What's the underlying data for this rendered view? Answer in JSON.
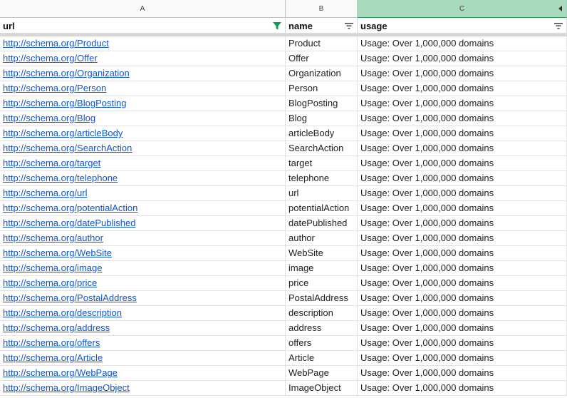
{
  "column_letters": [
    "A",
    "B",
    "C"
  ],
  "headers": {
    "url": "url",
    "name": "name",
    "usage": "usage"
  },
  "rows": [
    {
      "url": "http://schema.org/Product",
      "name": "Product",
      "usage": "Usage: Over 1,000,000 domains"
    },
    {
      "url": "http://schema.org/Offer",
      "name": "Offer",
      "usage": "Usage: Over 1,000,000 domains"
    },
    {
      "url": "http://schema.org/Organization",
      "name": "Organization",
      "usage": "Usage: Over 1,000,000 domains"
    },
    {
      "url": "http://schema.org/Person",
      "name": "Person",
      "usage": "Usage: Over 1,000,000 domains"
    },
    {
      "url": "http://schema.org/BlogPosting",
      "name": "BlogPosting",
      "usage": "Usage: Over 1,000,000 domains"
    },
    {
      "url": "http://schema.org/Blog",
      "name": "Blog",
      "usage": "Usage: Over 1,000,000 domains"
    },
    {
      "url": "http://schema.org/articleBody",
      "name": "articleBody",
      "usage": "Usage: Over 1,000,000 domains"
    },
    {
      "url": "http://schema.org/SearchAction",
      "name": "SearchAction",
      "usage": "Usage: Over 1,000,000 domains"
    },
    {
      "url": "http://schema.org/target",
      "name": "target",
      "usage": "Usage: Over 1,000,000 domains"
    },
    {
      "url": "http://schema.org/telephone",
      "name": "telephone",
      "usage": "Usage: Over 1,000,000 domains"
    },
    {
      "url": "http://schema.org/url",
      "name": "url",
      "usage": "Usage: Over 1,000,000 domains"
    },
    {
      "url": "http://schema.org/potentialAction",
      "name": "potentialAction",
      "usage": "Usage: Over 1,000,000 domains"
    },
    {
      "url": "http://schema.org/datePublished",
      "name": "datePublished",
      "usage": "Usage: Over 1,000,000 domains"
    },
    {
      "url": "http://schema.org/author",
      "name": "author",
      "usage": "Usage: Over 1,000,000 domains"
    },
    {
      "url": "http://schema.org/WebSite",
      "name": "WebSite",
      "usage": "Usage: Over 1,000,000 domains"
    },
    {
      "url": "http://schema.org/image",
      "name": "image",
      "usage": "Usage: Over 1,000,000 domains"
    },
    {
      "url": "http://schema.org/price",
      "name": "price",
      "usage": "Usage: Over 1,000,000 domains"
    },
    {
      "url": "http://schema.org/PostalAddress",
      "name": "PostalAddress",
      "usage": "Usage: Over 1,000,000 domains"
    },
    {
      "url": "http://schema.org/description",
      "name": "description",
      "usage": "Usage: Over 1,000,000 domains"
    },
    {
      "url": "http://schema.org/address",
      "name": "address",
      "usage": "Usage: Over 1,000,000 domains"
    },
    {
      "url": "http://schema.org/offers",
      "name": "offers",
      "usage": "Usage: Over 1,000,000 domains"
    },
    {
      "url": "http://schema.org/Article",
      "name": "Article",
      "usage": "Usage: Over 1,000,000 domains"
    },
    {
      "url": "http://schema.org/WebPage",
      "name": "WebPage",
      "usage": "Usage: Over 1,000,000 domains"
    },
    {
      "url": "http://schema.org/ImageObject",
      "name": "ImageObject",
      "usage": "Usage: Over 1,000,000 domains"
    }
  ],
  "colors": {
    "link": "#1155cc",
    "selected_column": "#a8dbbe",
    "active_filter": "#0f9d58"
  },
  "icons": {
    "url_filter": "filter-active-icon",
    "name_filter": "filter-icon",
    "usage_filter": "filter-icon",
    "column_c": "collapse-arrow-icon"
  }
}
